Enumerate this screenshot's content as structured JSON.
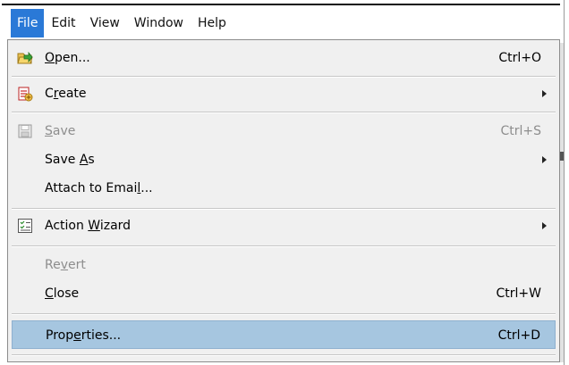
{
  "menubar": {
    "items": [
      {
        "label": "File"
      },
      {
        "label": "Edit"
      },
      {
        "label": "View"
      },
      {
        "label": "Window"
      },
      {
        "label": "Help"
      }
    ]
  },
  "file_menu": {
    "open": {
      "label_pre": "",
      "mnemonic": "O",
      "label_post": "pen...",
      "shortcut": "Ctrl+O",
      "icon": "folder-open-icon"
    },
    "create": {
      "label_pre": "C",
      "mnemonic": "r",
      "label_post": "eate",
      "icon": "create-pdf-icon"
    },
    "save": {
      "label_pre": "",
      "mnemonic": "S",
      "label_post": "ave",
      "shortcut": "Ctrl+S",
      "icon": "save-disk-icon",
      "disabled": true
    },
    "save_as": {
      "label_pre": "Save ",
      "mnemonic": "A",
      "label_post": "s"
    },
    "attach": {
      "label_pre": "Attach to Emai",
      "mnemonic": "l",
      "label_post": "..."
    },
    "action_wizard": {
      "label_pre": "Action ",
      "mnemonic": "W",
      "label_post": "izard",
      "icon": "checklist-icon"
    },
    "revert": {
      "label_pre": "Re",
      "mnemonic": "v",
      "label_post": "ert",
      "disabled": true
    },
    "close": {
      "label_pre": "",
      "mnemonic": "C",
      "label_post": "lose",
      "shortcut": "Ctrl+W"
    },
    "properties": {
      "label_pre": "Prop",
      "mnemonic": "e",
      "label_post": "rties...",
      "shortcut": "Ctrl+D",
      "highlighted": true
    }
  },
  "colors": {
    "menubar_active": "#2a79d7",
    "menu_background": "#f0f0f0",
    "highlight": "#a6c6e0",
    "disabled_text": "#8d8d8d"
  }
}
